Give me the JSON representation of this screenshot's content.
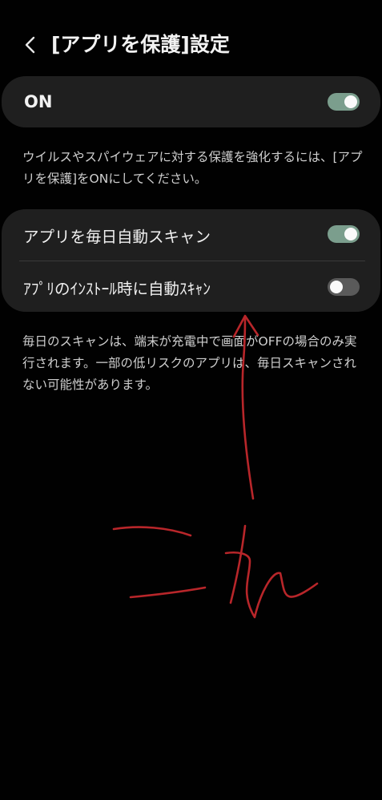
{
  "header": {
    "title": "[アプリを保護]設定",
    "back_icon": "chevron-left-icon"
  },
  "main_toggle": {
    "label": "ON",
    "state": "on"
  },
  "description_top": "ウイルスやスパイウェアに対する保護を強化するには、[アプリを保護]をONにしてください。",
  "settings": {
    "items": [
      {
        "label": "アプリを毎日自動スキャン",
        "state": "on"
      },
      {
        "label": "ｱﾌﾟﾘのｲﾝｽﾄｰﾙ時に自動ｽｷｬﾝ",
        "state": "off"
      }
    ]
  },
  "description_bottom": "毎日のスキャンは、端末が充電中で画面がOFFの場合のみ実行されます。一部の低リスクのアプリは、毎日スキャンされない可能性があります。",
  "annotation": {
    "text": "これ",
    "color": "#b8262a"
  },
  "colors": {
    "background": "#010101",
    "card": "#1f1f1f",
    "toggle_on": "#7b9e8d",
    "toggle_off": "#5a5a5a"
  }
}
